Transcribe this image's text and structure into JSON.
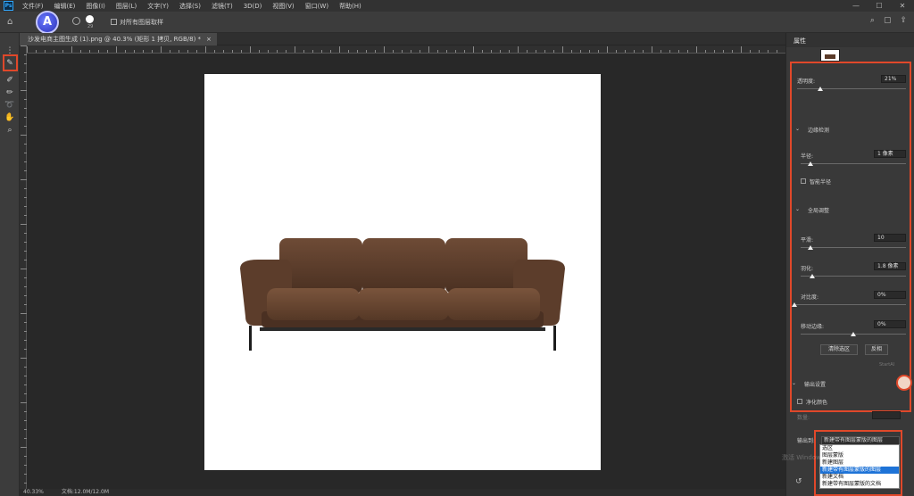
{
  "menubar": {
    "items": [
      "文件(F)",
      "编辑(E)",
      "图像(I)",
      "图层(L)",
      "文字(Y)",
      "选择(S)",
      "滤镜(T)",
      "3D(D)",
      "视图(V)",
      "窗口(W)",
      "帮助(H)"
    ]
  },
  "options": {
    "brush_size": "29",
    "sample_label": "对所有图层取样",
    "ai_badge": "A"
  },
  "document": {
    "tab_label": "沙发电商主图生成 (1).png @ 40.3% (矩形 1 拷贝, RGB/8) *",
    "close": "×"
  },
  "status": {
    "zoom": "40.33%",
    "doc_size": "文档:12.0M/12.0M"
  },
  "panel": {
    "title": "属性",
    "transparency_label": "透明度:",
    "transparency_value": "21%",
    "transparency_level": 0.21,
    "edge_section": "边缘检测",
    "radius_label": "半径:",
    "radius_value": "1 像素",
    "smart_radius_label": "智能半径",
    "global_section": "全局调整",
    "smooth_label": "平滑:",
    "smooth_value": "10",
    "feather_label": "羽化:",
    "feather_value": "1.8 像素",
    "contrast_label": "对比度:",
    "contrast_value": "0%",
    "shift_label": "移动边缘:",
    "shift_value": "0%",
    "clear_button": "清除选区",
    "invert_button": "反相",
    "output_section": "输出设置",
    "decontam_label": "净化颜色",
    "amount_label": "数量:",
    "output_to_label": "输出到:"
  },
  "dropdown": {
    "selected": "新建带有图层蒙版的图层",
    "options": [
      "选区",
      "图层蒙版",
      "新建图层",
      "新建带有图层蒙版的图层",
      "新建文档",
      "新建带有图层蒙版的文档"
    ],
    "selected_index": 3
  },
  "watermark": "激活 Windows",
  "startai": "StartAI"
}
